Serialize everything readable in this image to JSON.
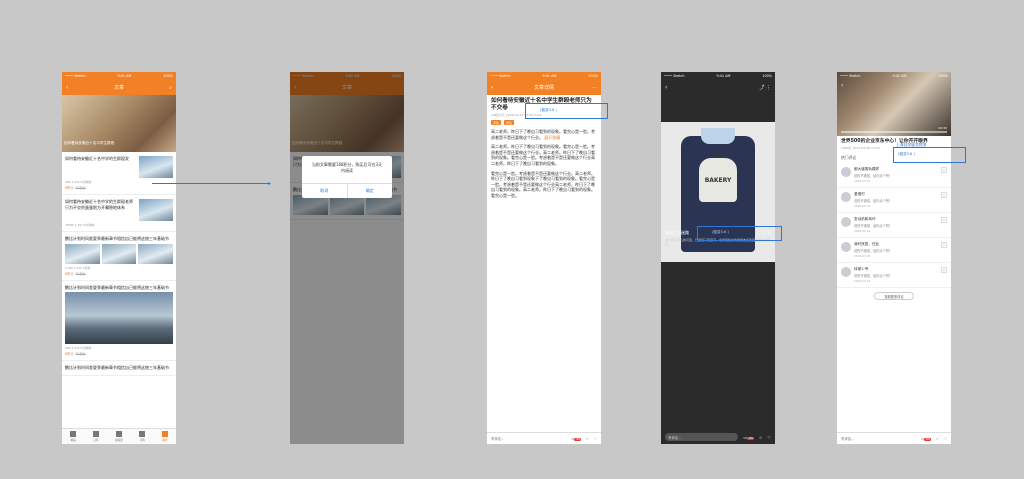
{
  "status": {
    "carrier": "•••• Sketch",
    "time": "9:41 AM",
    "battery": "100%"
  },
  "screen1": {
    "nav_title": "文章",
    "hero_caption": "如何看待安徽近十名中学生群殴",
    "items": [
      {
        "title": "如何看待安徽近十名中学的生群殴发",
        "meta": "482  1.3W  5分钟前",
        "points": "8积分",
        "old": "88积分",
        "badge": "热门"
      },
      {
        "title": "如何看待安徽近十名中学的生群殴老师只为不交的蛋蛋地方开唰隐地体系",
        "meta": "783W  1.3W  5分钟前",
        "points": "",
        "old": ""
      },
      {
        "title": "鹏比计划时间差夏季最新章节相信自己能将这统三年基础节",
        "meta": "4.4W  1.1W  1天前",
        "points": "8积分",
        "old": "88积分"
      },
      {
        "title": "鹏比计划时间差夏季最新章节相信自己能将这统三年基础节",
        "meta": "483  1.3W  5分钟前",
        "points": "8积分",
        "old": "88积分"
      },
      {
        "title": "鹏比计划时间差夏季最新章节相信自己能将这统三年基础节",
        "meta": "",
        "points": "",
        "old": ""
      }
    ],
    "tabs": [
      "精品",
      "订阅",
      "拍案果",
      "问答",
      "我的"
    ]
  },
  "screen2": {
    "nav_title": "文章",
    "dialog_message": "当前文章需要168积分，购买后可在3天内阅读",
    "cancel": "取消",
    "confirm": "确定"
  },
  "screen3": {
    "nav_title": "文章详情",
    "title": "如何看待安徽近十名中学生群殴老师只为不交卷",
    "annotation": "(粗变3.6 )",
    "meta": "24积分/元 2016-04-29 16:44  2.1W",
    "tags": [
      "问答",
      "评论"
    ],
    "para1": "高二老师。昨日下了晚自习看到的现象。看完心是一脸。考虑着是不是还要做这个行业。",
    "link": "展开隐藏",
    "para2": "高二老师。昨日下了晚自习看到的现象。看完心是一脸。考虑着是不是还要做这个行业。高二老师。昨日下了晚自习看到的现象。看完心是一脸。考虑着是不是还要做这个行业高二老师。昨日下了晚自习看到的现象。",
    "para3": "看完心是一脸。考虑着是不是还要做这个行业。高二老师。昨日下了晚自习看到现象下了晚自习看到的现象。看完心是一脸。考虑着是不是还要做这个行业高二老师。昨日下了晚自习看到的现象。高二老师。昨日下了晚自习看到的现象。看完心是一脸。",
    "write": "写评论...",
    "badge": "139"
  },
  "screen4": {
    "caption": "张纳兰与迷路",
    "annotation": "(粗变3.6 )",
    "page": "1 / 4",
    "sub": "这个孩子真心的可爱，已经接了四百万，全靠着纪力的健康去走着回家的路虚荣心。",
    "bakery": "BAKERY",
    "write": "写评论...",
    "badge": "139"
  },
  "screen5": {
    "title": "世界500的企业京东中心！让你开开眼界",
    "sub_title": "上海自奔展览物流",
    "annotation": "(粗变3.6 )",
    "meta": "1083万  2017-03-29 14:04",
    "time": "02:36",
    "hot": "热门评论",
    "comments": [
      {
        "name": "都大道蒸轨模样",
        "text": "说的不错啦，给你点个赞!",
        "date": "2016-03-19"
      },
      {
        "name": "爱慢村",
        "text": "说的不错啦，给你点个赞!",
        "date": "2016-03-19"
      },
      {
        "name": "发动机和商坏",
        "text": "说的不错啦，给你点个赞!",
        "date": "2016-03-19"
      },
      {
        "name": "我时良居、在此",
        "text": "说的不错啦，给你点个赞!",
        "date": "2016-03-19"
      },
      {
        "name": "体家少爷",
        "text": "说的不错啦，给你点个赞!",
        "date": "2016-03-19"
      }
    ],
    "more": "查看更多评论",
    "write": "写评论...",
    "badge": "139"
  },
  "colors": {
    "accent": "#f28025",
    "annotation": "#2f78d0",
    "canvas": "#c8c8c8"
  }
}
